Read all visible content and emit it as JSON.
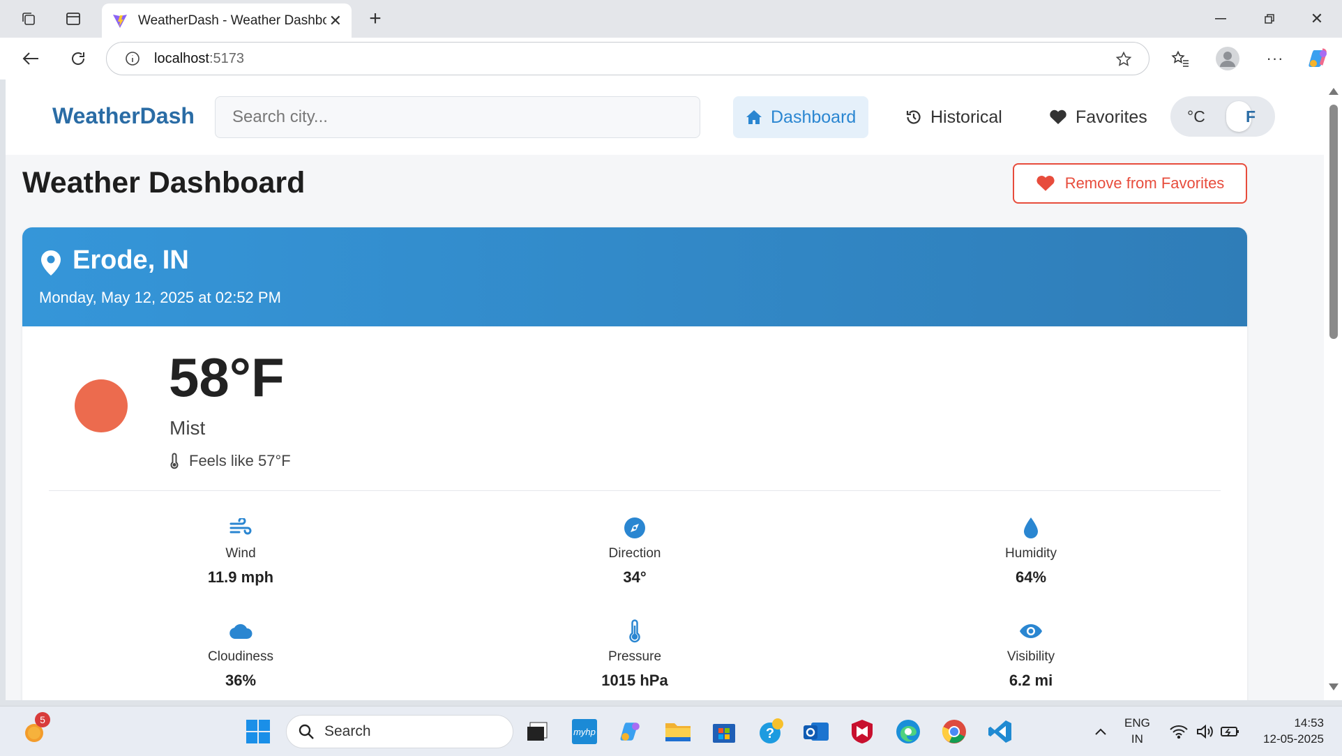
{
  "browser": {
    "tab_title": "WeatherDash - Weather Dashboard",
    "url_host": "localhost",
    "url_port": ":5173"
  },
  "nav": {
    "brand": "WeatherDash",
    "search_placeholder": "Search city...",
    "links": [
      {
        "label": "Dashboard",
        "icon": "home-icon",
        "active": true
      },
      {
        "label": "Historical",
        "icon": "history-icon",
        "active": false
      },
      {
        "label": "Favorites",
        "icon": "heart-icon",
        "active": false
      }
    ],
    "unit_celsius": "°C",
    "unit_fahrenheit": "F",
    "unit_selected": "F"
  },
  "page": {
    "title": "Weather Dashboard",
    "favorite_button": "Remove from Favorites"
  },
  "weather": {
    "city": "Erode, IN",
    "datetime": "Monday, May 12, 2025 at 02:52 PM",
    "temperature": "58°F",
    "condition": "Mist",
    "feels_like": "Feels like 57°F",
    "stats": [
      {
        "label": "Wind",
        "value": "11.9 mph",
        "icon": "wind-icon"
      },
      {
        "label": "Direction",
        "value": "34°",
        "icon": "compass-icon"
      },
      {
        "label": "Humidity",
        "value": "64%",
        "icon": "droplet-icon"
      },
      {
        "label": "Cloudiness",
        "value": "36%",
        "icon": "cloud-icon"
      },
      {
        "label": "Pressure",
        "value": "1015 hPa",
        "icon": "thermometer-icon"
      },
      {
        "label": "Visibility",
        "value": "6.2 mi",
        "icon": "eye-icon"
      }
    ]
  },
  "taskbar": {
    "notification_count": "5",
    "search_label": "Search",
    "lang_line1": "ENG",
    "lang_line2": "IN",
    "time": "14:53",
    "date": "12-05-2025"
  },
  "colors": {
    "accent": "#2a86d1",
    "brand": "#2a6ca5",
    "danger": "#e74c3c",
    "header_gradient_start": "#3596d9",
    "header_gradient_end": "#2f7db8",
    "sun": "#ec6b4e"
  }
}
